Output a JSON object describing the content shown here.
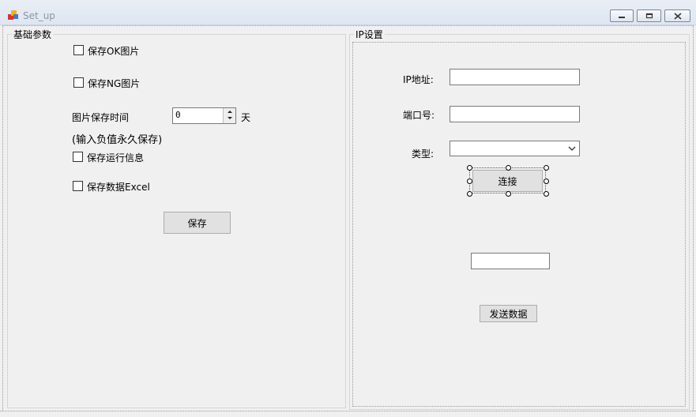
{
  "window": {
    "title": "Set_up",
    "icons": {
      "app": "app-icon",
      "minimize": "minimize-icon",
      "maximize": "maximize-icon",
      "close": "close-icon"
    }
  },
  "basic": {
    "group_title": "基础参数",
    "save_ok_label": "保存OK图片",
    "save_ng_label": "保存NG图片",
    "keep_time_label": "图片保存时间",
    "keep_time_value": "0",
    "keep_time_unit": "天",
    "keep_hint": "(输入负值永久保存)",
    "save_run_info_label": "保存运行信息",
    "save_excel_label": "保存数据Excel",
    "save_button": "保存"
  },
  "ip": {
    "group_title": "IP设置",
    "ip_label": "IP地址:",
    "ip_value": "",
    "port_label": "端口号:",
    "port_value": "",
    "type_label": "类型:",
    "type_value": "",
    "connect_button": "连接",
    "send_value": "",
    "send_button": "发送数据"
  }
}
